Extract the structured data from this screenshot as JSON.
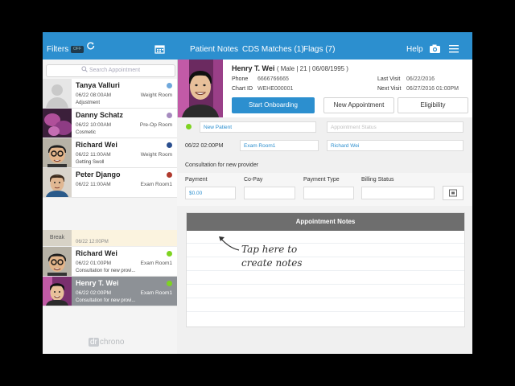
{
  "topbar": {
    "filters_label": "Filters",
    "toggle_text": "OFF",
    "tabs": [
      {
        "label": "Patient Notes"
      },
      {
        "label": "CDS Matches (1)"
      },
      {
        "label": "Flags (7)"
      }
    ],
    "help_label": "Help"
  },
  "sidebar": {
    "search_placeholder": "Search Appointment",
    "appointments": [
      {
        "name": "Tanya Valluri",
        "datetime": "06/22 08:00AM",
        "room": "Weight Room",
        "note": "Adjustment",
        "status_color": "#6fa8dc"
      },
      {
        "name": "Danny Schatz",
        "datetime": "06/22 10:00AM",
        "room": "Pre-Op Room",
        "note": "Cosmetic",
        "status_color": "#a68bbf"
      },
      {
        "name": "Richard Wei",
        "datetime": "06/22 11:00AM",
        "room": "Weight Room",
        "note": "Getting Swoll",
        "status_color": "#2a4f8f"
      },
      {
        "name": "Peter Django",
        "datetime": "06/22 11:00AM",
        "room": "Exam Room1",
        "note": "",
        "status_color": "#b03a2e"
      },
      {
        "name": "Richard Wei",
        "datetime": "06/22 01:00PM",
        "room": "Exam Room1",
        "note": "Consultation for new provi...",
        "status_color": "#7ed321"
      },
      {
        "name": "Henry T. Wei",
        "datetime": "06/22 02:00PM",
        "room": "Exam Room1",
        "note": "Consultation for new provi...",
        "status_color": "#7ed321"
      }
    ],
    "break": {
      "label": "Break",
      "time": "06/22 12:00PM"
    },
    "logo_dr": "dr",
    "logo_text": "chrono"
  },
  "patient": {
    "name": "Henry T. Wei",
    "demographics": "( Male | 21 | 06/08/1995 )",
    "phone_label": "Phone",
    "phone": "6666766665",
    "chart_label": "Chart ID",
    "chart_id": "WEHE000001",
    "last_visit_label": "Last Visit",
    "last_visit": "06/22/2016",
    "next_visit_label": "Next Visit",
    "next_visit": "06/27/2016 01:00PM"
  },
  "actions": {
    "onboarding": "Start Onboarding",
    "new_appointment": "New Appointment",
    "eligibility": "Eligibility"
  },
  "appointment": {
    "status_color": "#7ed321",
    "status_value": "New Patient",
    "appointment_status_placeholder": "Appointment Status",
    "datetime": "06/22 02:00PM",
    "room": "Exam Room1",
    "provider": "Richard Wei",
    "reason": "Consultation for new provider",
    "payment_label": "Payment",
    "payment_value": "$0.00",
    "copay_label": "Co-Pay",
    "payment_type_label": "Payment Type",
    "billing_status_label": "Billing Status"
  },
  "notes": {
    "title": "Appointment Notes",
    "hint_line1": "Tap here to",
    "hint_line2": "create notes"
  }
}
